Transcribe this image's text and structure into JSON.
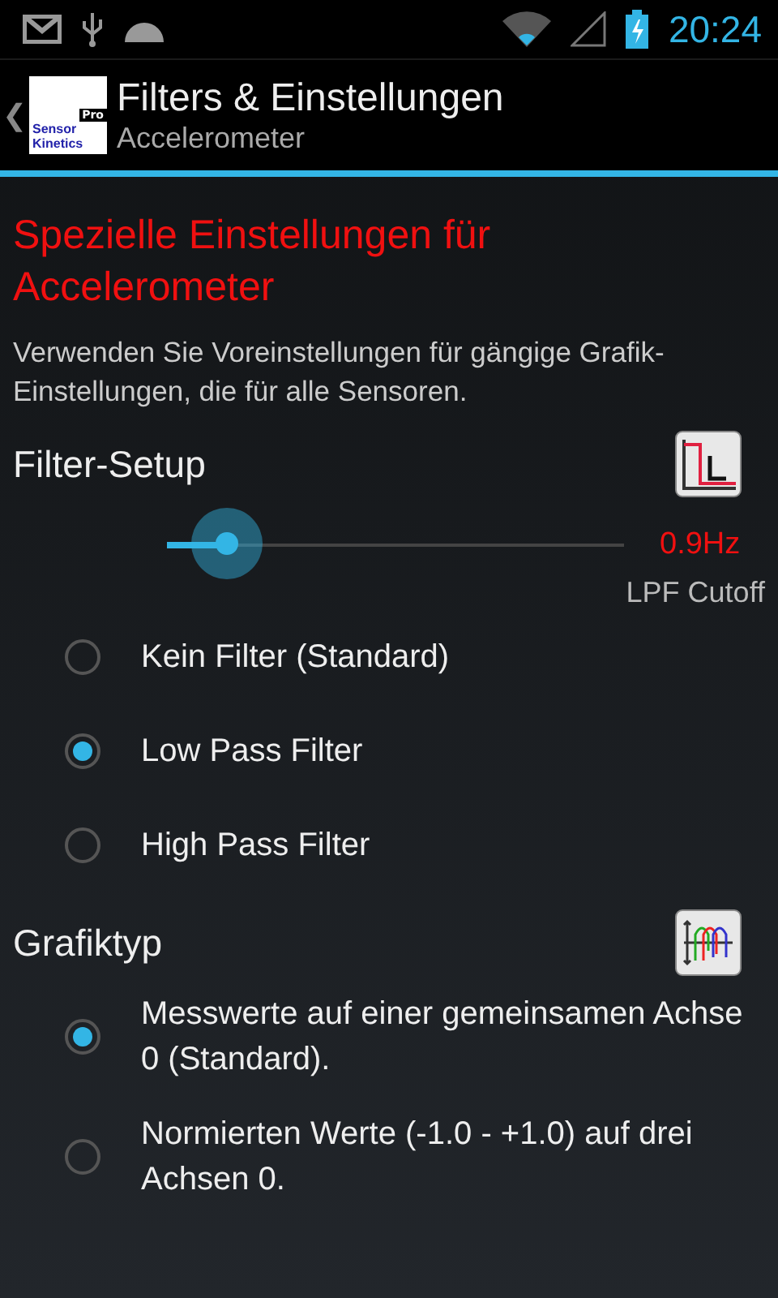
{
  "status_bar": {
    "time": "20:24"
  },
  "action_bar": {
    "back": "❮",
    "logo": {
      "line1": "Sensor",
      "line2": "Kinetics",
      "badge": "Pro"
    },
    "title": "Filters & Einstellungen",
    "subtitle": "Accelerometer"
  },
  "heading": "Spezielle Einstellungen für Accelerometer",
  "description": "Verwenden Sie Voreinstellungen für gängige Grafik-Einstellungen, die für alle Sensoren.",
  "filter_section": {
    "title": "Filter-Setup",
    "slider": {
      "level": 0.13,
      "reading": "0.9Hz",
      "label": "LPF Cutoff"
    },
    "options": [
      {
        "label": "Kein Filter (Standard)",
        "selected": false
      },
      {
        "label": "Low Pass Filter",
        "selected": true
      },
      {
        "label": "High Pass Filter",
        "selected": false
      }
    ]
  },
  "graph_section": {
    "title": "Grafiktyp",
    "options": [
      {
        "label": "Messwerte auf einer gemeinsamen Achse 0 (Standard).",
        "selected": true
      },
      {
        "label": "Normierten Werte (-1.0 - +1.0) auf drei Achsen 0.",
        "selected": false
      }
    ]
  }
}
